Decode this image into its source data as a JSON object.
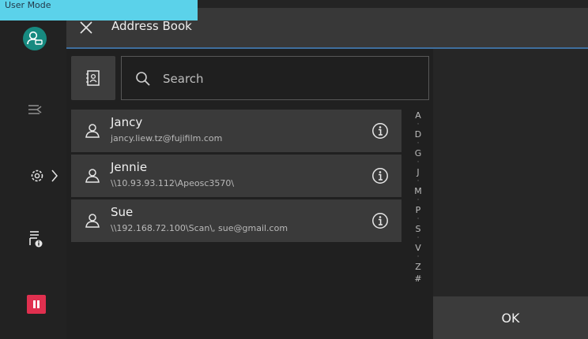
{
  "mode_label": "User Mode",
  "title": "Address Book",
  "search": {
    "placeholder": "Search",
    "value": ""
  },
  "contacts": [
    {
      "name": "Jancy",
      "detail": "jancy.liew.tz@fujifilm.com"
    },
    {
      "name": "Jennie",
      "detail": "\\\\10.93.93.112\\Apeosc3570\\"
    },
    {
      "name": "Sue",
      "detail": "\\\\192.168.72.100\\Scan\\, sue@gmail.com"
    }
  ],
  "index": [
    "A",
    "D",
    "G",
    "J",
    "M",
    "P",
    "S",
    "V",
    "Z",
    "#"
  ],
  "ok_label": "OK",
  "colors": {
    "accent": "#5bd2ea",
    "user_avatar": "#178a80",
    "pause": "#e0304f",
    "background": "#242424"
  },
  "icons": {
    "user_mode": "user-login-icon",
    "close": "close-icon",
    "transfer": "job-transfer-icon",
    "settings": "gear-icon",
    "device_info": "printer-info-icon",
    "pause": "pause-icon",
    "address_book": "address-book-icon",
    "search": "search-icon",
    "contact": "person-icon",
    "info": "info-icon"
  }
}
